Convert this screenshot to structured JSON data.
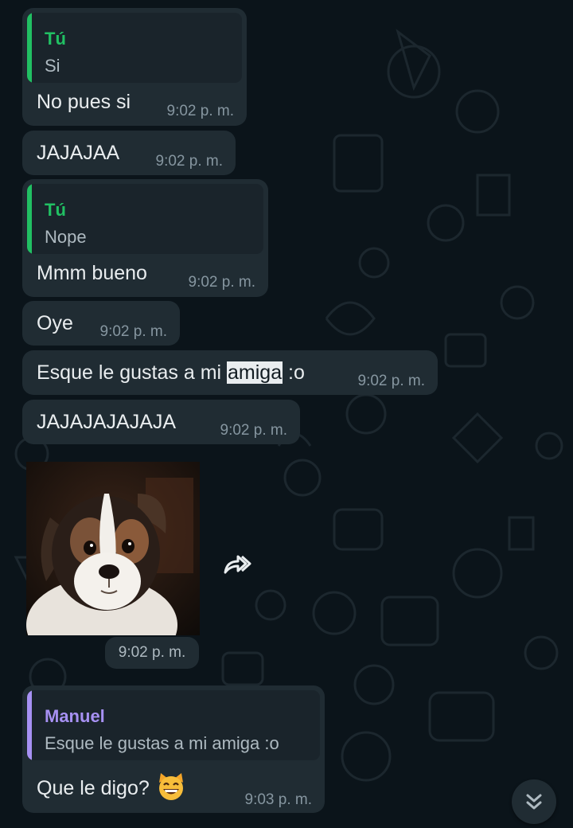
{
  "colors": {
    "chat_background": "#0b141a",
    "bubble": "#202c33",
    "quote_self": "#21c063",
    "quote_other": "#a791f3",
    "timestamp": "#8696a0"
  },
  "messages": [
    {
      "quote": {
        "author": "Tú",
        "text": "Si"
      },
      "text": "No pues si",
      "time": "9:02 p. m."
    },
    {
      "text": "JAJAJAA",
      "time": "9:02 p. m."
    },
    {
      "quote": {
        "author": "Tú",
        "text": "Nope"
      },
      "text": "Mmm bueno",
      "time": "9:02 p. m."
    },
    {
      "text": "Oye",
      "time": "9:02 p. m."
    },
    {
      "text_before": "Esque le gustas a mi ",
      "text_highlight": "amiga",
      "text_after": " :o",
      "time": "9:02 p. m."
    },
    {
      "text": "JAJAJAJAJAJA",
      "time": "9:02 p. m."
    },
    {
      "sticker": "puppy-sticker",
      "time": "9:02 p. m."
    },
    {
      "quote": {
        "author": "Manuel",
        "text": "Esque le gustas a mi amiga :o"
      },
      "text": "Que le digo?",
      "emoji": "grinning-cat-emoji",
      "time": "9:03 p. m."
    }
  ],
  "icons": {
    "forward": "forward-icon",
    "scroll_down": "double-chevron-down-icon"
  }
}
